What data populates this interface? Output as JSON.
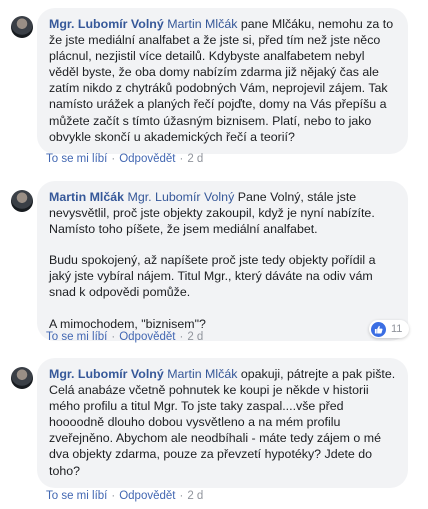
{
  "comments": [
    {
      "author": "Mgr. Lubomír Volný",
      "mention": "Martin Mlčák",
      "paragraphs": [
        "pane Mlčáku, nemohu za to že jste mediální analfabet a že jste si, před tím než jste něco plácnul, nezjistil více detailů. Kdybyste analfabetem nebyl věděl byste, že oba domy nabízím zdarma již nějaký čas ale zatím nikdo z chytráků podobných Vám, neprojevil zájem. Tak namísto urážek a planých řečí pojďte, domy na Vás přepíšu a můžete začít s tímto úžasným biznisem. Platí, nebo to jako obvykle skončí u akademických řečí a teorií?"
      ],
      "like_label": "To se mi líbí",
      "reply_label": "Odpovědět",
      "time": "2 d"
    },
    {
      "author": "Martin Mlčák",
      "mention": "Mgr. Lubomír Volný",
      "paragraphs": [
        "Pane Volný, stále jste nevysvětlil, proč jste objekty zakoupil, když je nyní nabízíte. Namísto toho píšete, že jsem mediální analfabet.",
        "Budu spokojený, až napíšete proč jste tedy objekty pořídil a jaký jste vybíral nájem. Titul Mgr., který dáváte na odiv vám snad k odpovědi pomůže.",
        "A mimochodem, \"biznisem\"?"
      ],
      "like_label": "To se mi líbí",
      "reply_label": "Odpovědět",
      "time": "2 d",
      "reaction_count": "11"
    },
    {
      "author": "Mgr. Lubomír Volný",
      "mention": "Martin Mlčák",
      "paragraphs": [
        "opakuji, pátrejte a pak pište. Celá anabáze včetně pohnutek ke koupi je někde v historii mého profilu a titul Mgr. To jste taky zaspal....vše před hoooodně dlouho dobou vysvětleno a na mém profilu zveřejněno. Abychom ale neodbíhali - máte tedy zájem o mé dva objekty zdarma, pouze za převzetí hypotéky? Jdete do toho?"
      ],
      "like_label": "To se mi líbí",
      "reply_label": "Odpovědět",
      "time": "2 d"
    }
  ]
}
